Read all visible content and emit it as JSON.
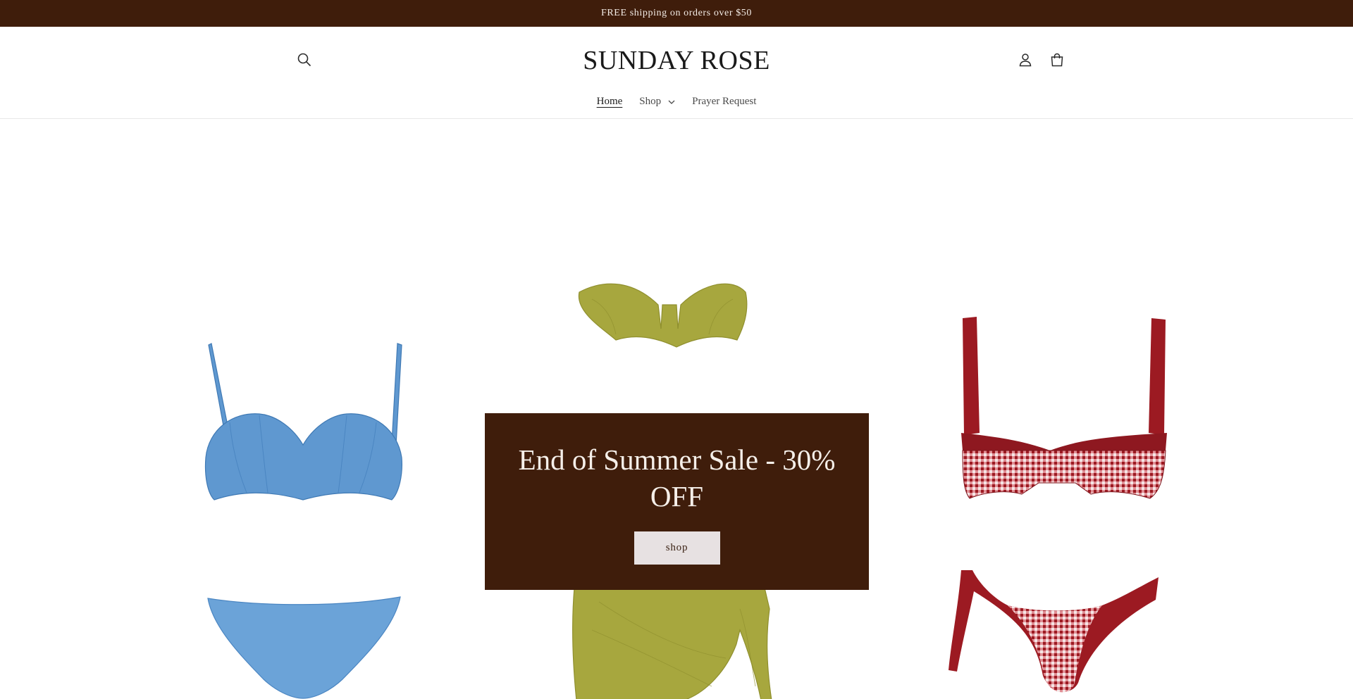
{
  "announcement": {
    "text": "FREE shipping on orders over $50"
  },
  "header": {
    "logo": "SUNDAY ROSE",
    "icons": {
      "search": "search-icon",
      "account": "account-icon",
      "cart": "cart-icon"
    }
  },
  "nav": {
    "items": [
      {
        "label": "Home",
        "active": true
      },
      {
        "label": "Shop",
        "has_dropdown": true
      },
      {
        "label": "Prayer Request"
      }
    ]
  },
  "hero": {
    "heading": "End of Summer Sale - 30% OFF",
    "button_label": "shop",
    "products": [
      "blue-bikini-image",
      "olive-bandeau-sarong-image",
      "red-gingham-bikini-image"
    ]
  },
  "colors": {
    "brand_brown": "#3f1d0b",
    "button_bg": "#e7e1e2",
    "blue": "#5f98d0",
    "olive": "#a7a73e",
    "red": "#9c1a22"
  }
}
